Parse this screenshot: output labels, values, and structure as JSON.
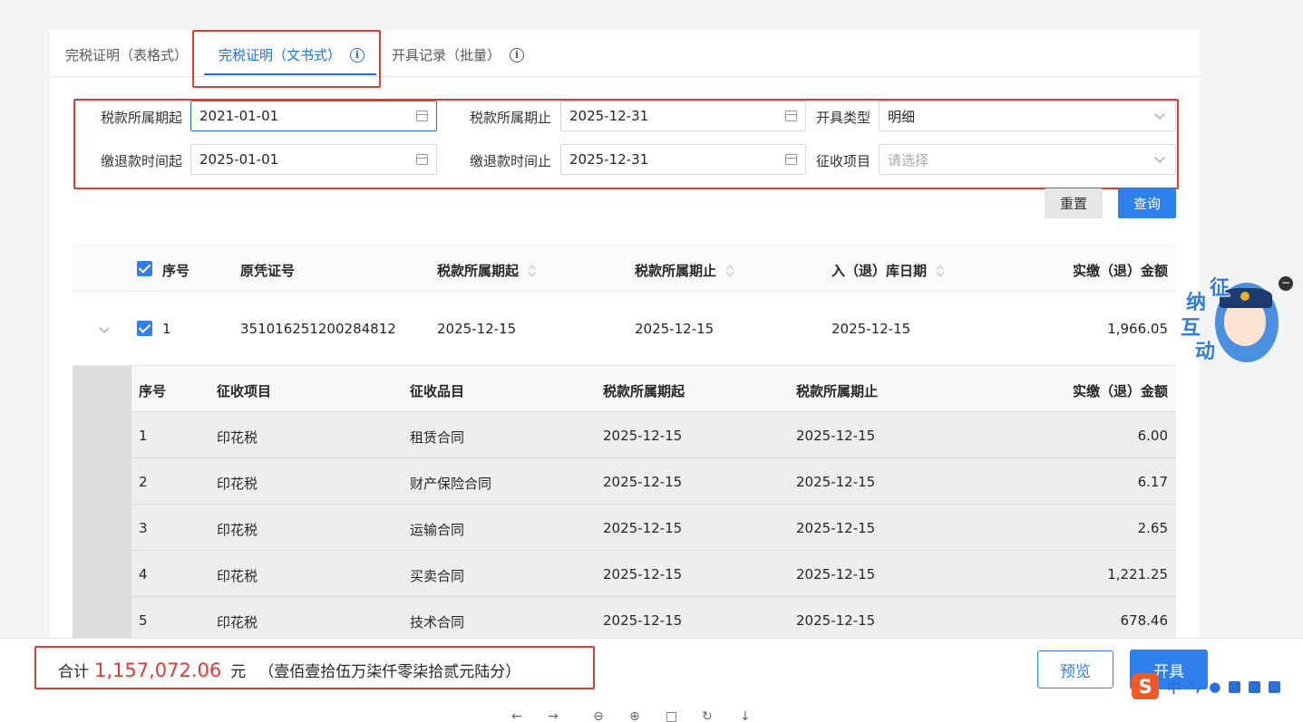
{
  "tabs": [
    {
      "label": "完税证明（表格式）"
    },
    {
      "label": "完税证明（文书式）",
      "active": true
    },
    {
      "label": "开具记录（批量）"
    }
  ],
  "info_glyph": "i",
  "form": {
    "tax_period_start_label": "税款所属期起",
    "tax_period_start_value": "2021-01-01",
    "tax_period_end_label": "税款所属期止",
    "tax_period_end_value": "2025-12-31",
    "issue_type_label": "开具类型",
    "issue_type_value": "明细",
    "pay_time_start_label": "缴退款时间起",
    "pay_time_start_value": "2025-01-01",
    "pay_time_end_label": "缴退款时间止",
    "pay_time_end_value": "2025-12-31",
    "levy_item_label": "征收项目",
    "levy_item_placeholder": "请选择"
  },
  "buttons": {
    "reset": "重置",
    "query": "查询",
    "preview": "预览",
    "issue": "开具"
  },
  "main_table": {
    "headers": {
      "seq": "序号",
      "voucher": "原凭证号",
      "period_start": "税款所属期起",
      "period_end": "税款所属期止",
      "in_date": "入（退）库日期",
      "amount": "实缴（退）金额"
    },
    "rows": [
      {
        "seq": "1",
        "voucher": "351016251200284812",
        "period_start": "2025-12-15",
        "period_end": "2025-12-15",
        "in_date": "2025-12-15",
        "amount": "1,966.05"
      }
    ]
  },
  "sub_table": {
    "headers": {
      "seq": "序号",
      "item": "征收项目",
      "subitem": "征收品目",
      "period_start": "税款所属期起",
      "period_end": "税款所属期止",
      "amount": "实缴（退）金额"
    },
    "rows": [
      {
        "seq": "1",
        "item": "印花税",
        "subitem": "租赁合同",
        "period_start": "2025-12-15",
        "period_end": "2025-12-15",
        "amount": "6.00"
      },
      {
        "seq": "2",
        "item": "印花税",
        "subitem": "财产保险合同",
        "period_start": "2025-12-15",
        "period_end": "2025-12-15",
        "amount": "6.17"
      },
      {
        "seq": "3",
        "item": "印花税",
        "subitem": "运输合同",
        "period_start": "2025-12-15",
        "period_end": "2025-12-15",
        "amount": "2.65"
      },
      {
        "seq": "4",
        "item": "印花税",
        "subitem": "买卖合同",
        "period_start": "2025-12-15",
        "period_end": "2025-12-15",
        "amount": "1,221.25"
      },
      {
        "seq": "5",
        "item": "印花税",
        "subitem": "技术合同",
        "period_start": "2025-12-15",
        "period_end": "2025-12-15",
        "amount": "678.46"
      }
    ]
  },
  "total": {
    "label": "合计",
    "amount": "1,157,072.06",
    "unit": "元",
    "chinese": "（壹佰壹拾伍万柒仟零柒拾贰元陆分）"
  },
  "assistant": {
    "chars": [
      "征",
      "纳",
      "互",
      "动"
    ],
    "close": "−"
  },
  "ime": {
    "logo": "S",
    "mode": "中",
    "punct": "°,"
  },
  "viewer_icons": [
    "arrow-left-icon",
    "arrow-right-icon",
    "zoom-out-icon",
    "zoom-in-icon",
    "fit-page-icon",
    "rotate-icon",
    "download-icon"
  ],
  "colors": {
    "primary": "#2f80ed",
    "highlight": "#e53935"
  }
}
